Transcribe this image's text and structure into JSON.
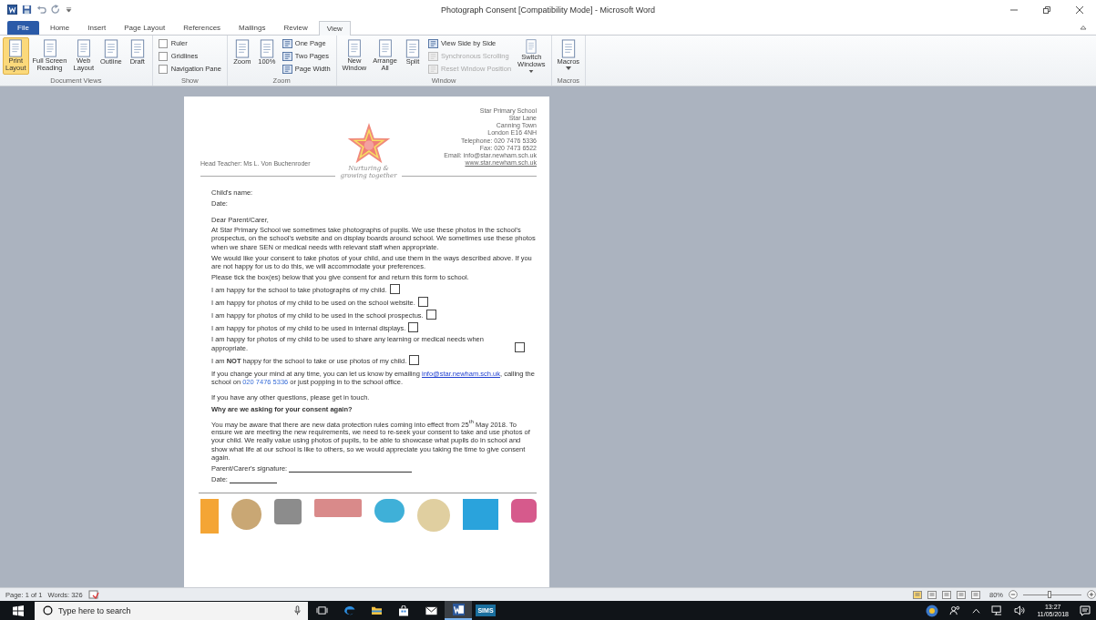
{
  "window": {
    "title": "Photograph Consent [Compatibility Mode] - Microsoft Word"
  },
  "tabs": [
    {
      "label": "File",
      "selected": false,
      "kind": "backstage"
    },
    {
      "label": "Home",
      "selected": false,
      "kind": "tab"
    },
    {
      "label": "Insert",
      "selected": false,
      "kind": "tab"
    },
    {
      "label": "Page Layout",
      "selected": false,
      "kind": "tab"
    },
    {
      "label": "References",
      "selected": false,
      "kind": "tab"
    },
    {
      "label": "Mailings",
      "selected": false,
      "kind": "tab"
    },
    {
      "label": "Review",
      "selected": false,
      "kind": "tab"
    },
    {
      "label": "View",
      "selected": true,
      "kind": "tab"
    }
  ],
  "ribbon_groups": [
    {
      "label": "Document Views",
      "items": [
        {
          "kind": "large",
          "label": "Print\nLayout",
          "selected": true
        },
        {
          "kind": "large",
          "label": "Full Screen\nReading",
          "selected": false
        },
        {
          "kind": "large",
          "label": "Web\nLayout",
          "selected": false
        },
        {
          "kind": "large",
          "label": "Outline",
          "selected": false
        },
        {
          "kind": "large",
          "label": "Draft",
          "selected": false
        }
      ]
    },
    {
      "label": "Show",
      "items": [
        {
          "kind": "stack",
          "items": [
            {
              "kind": "check",
              "label": "Ruler",
              "checked": false
            },
            {
              "kind": "check",
              "label": "Gridlines",
              "checked": false
            },
            {
              "kind": "check",
              "label": "Navigation Pane",
              "checked": false
            }
          ]
        }
      ]
    },
    {
      "label": "Zoom",
      "items": [
        {
          "kind": "large",
          "label": "Zoom"
        },
        {
          "kind": "large",
          "label": "100%"
        },
        {
          "kind": "stack",
          "items": [
            {
              "kind": "small",
              "label": "One Page",
              "disabled": false
            },
            {
              "kind": "small",
              "label": "Two Pages",
              "disabled": false
            },
            {
              "kind": "small",
              "label": "Page Width",
              "disabled": false
            }
          ]
        }
      ]
    },
    {
      "label": "Window",
      "items": [
        {
          "kind": "large",
          "label": "New\nWindow"
        },
        {
          "kind": "large",
          "label": "Arrange\nAll"
        },
        {
          "kind": "large",
          "label": "Split"
        },
        {
          "kind": "stack",
          "items": [
            {
              "kind": "small",
              "label": "View Side by Side",
              "disabled": false
            },
            {
              "kind": "small",
              "label": "Synchronous Scrolling",
              "disabled": true
            },
            {
              "kind": "small",
              "label": "Reset Window Position",
              "disabled": true
            }
          ]
        },
        {
          "kind": "large",
          "label": "Switch\nWindows",
          "menu": true
        }
      ]
    },
    {
      "label": "Macros",
      "items": [
        {
          "kind": "large",
          "label": "Macros",
          "menu": true
        }
      ]
    }
  ],
  "document": {
    "letterhead": {
      "head_teacher": "Head Teacher: Ms L. Von Buchenroder",
      "motto": [
        "Nurturing &",
        "growing together"
      ],
      "address": [
        "Star Primary School",
        "Star Lane",
        "Canning Town",
        "London E16 4NH",
        "Telephone: 020 7476 5336",
        "Fax: 020 7473 6522",
        "Email: info@star.newham.sch.uk"
      ],
      "website": "www.star.newham.sch.uk"
    },
    "fields": [
      "Child's name:",
      "Date:"
    ],
    "greeting": "Dear Parent/Carer,",
    "paragraphs": [
      "At Star Primary School we sometimes take photographs of pupils. We use these photos in the school's prospectus, on the school's website and on display boards around school. We sometimes use these photos when we share SEN or medical needs with relevant staff when appropriate.",
      "We would like your consent to take photos of your child, and use them in the ways described above. If you are not happy for us to do this, we will accommodate your preferences.",
      "Please tick the box(es) below that you give consent for and return this form to school."
    ],
    "consents": [
      {
        "text": "I am happy for the school to take photographs of my child.",
        "checked": false
      },
      {
        "text": "I am happy for photos of my child to be used on the school website.",
        "checked": false
      },
      {
        "text": "I am happy for photos of my child to be used in the school prospectus.",
        "checked": false
      },
      {
        "text": "I am happy for photos of my child to be used in internal displays.",
        "checked": false
      },
      {
        "text": "I am happy for photos of my child to be used to share any learning or medical needs when appropriate.",
        "checked": false
      },
      {
        "text": "I am **NOT** happy for the school to take or use photos of my child.",
        "checked": false
      }
    ],
    "contact": [
      {
        "kind": "text",
        "text": "If you change your mind at any time, you can let us know by emailing "
      },
      {
        "kind": "email",
        "text": "info@star.newham.sch.uk"
      },
      {
        "kind": "text",
        "text": ", calling the school on "
      },
      {
        "kind": "phone",
        "text": "020 7476 5336"
      },
      {
        "kind": "text",
        "text": " or just popping in to the school office."
      }
    ],
    "questions": "If you have any other questions, please get in touch.",
    "heading": "Why are we asking for your consent again?",
    "explanation": "You may be aware that there are new data protection rules coming into effect from 25$^{th}$ May 2018. To ensure we are meeting the new requirements, we need to re-seek your consent to take and use photos of your child. We really value using photos of pupils, to be able to showcase what pupils do in school and show what life at our school is like to others, so we would appreciate you taking the time to give consent again.",
    "signature_label": "Parent/Carer's signature:",
    "date_label": "Date:"
  },
  "status_bar": {
    "page": "Page: 1 of 1",
    "words": "Words: 326",
    "zoom": "80%",
    "zoom_slider": {
      "level": 0.45
    }
  },
  "taskbar": {
    "search": {
      "placeholder": "Type here to search"
    },
    "apps": [
      {
        "kind": "taskview",
        "selected": false
      },
      {
        "kind": "edge",
        "selected": false
      },
      {
        "kind": "explorer",
        "selected": false
      },
      {
        "kind": "store",
        "selected": false
      },
      {
        "kind": "mail",
        "selected": false
      },
      {
        "kind": "word",
        "selected": true
      },
      {
        "kind": "sims",
        "label": "SIMS",
        "selected": false
      }
    ],
    "time": "13:27",
    "date": "11/05/2018"
  }
}
